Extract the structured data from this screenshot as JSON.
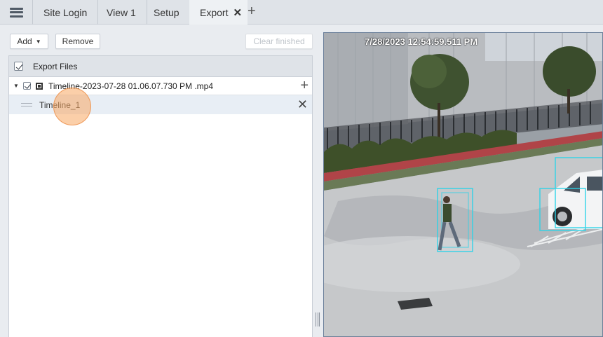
{
  "tabs": [
    {
      "label": "Site Login",
      "active": false
    },
    {
      "label": "View 1",
      "active": false
    },
    {
      "label": "Setup",
      "active": false
    },
    {
      "label": "Export",
      "active": true
    }
  ],
  "icons": {
    "menu": "hamburger-menu-icon",
    "tab_close": "close-icon",
    "tab_add": "plus-icon",
    "row_add": "plus-icon",
    "row_remove": "close-icon",
    "file": "film-icon",
    "expand": "caret-down-icon",
    "drag": "drag-handle-icon"
  },
  "toolbar": {
    "add_label": "Add",
    "remove_label": "Remove",
    "clear_label": "Clear finished"
  },
  "export_panel": {
    "header_label": "Export Files",
    "files": [
      {
        "name": "Timeline-2023-07-28 01.06.07.730 PM .mp4",
        "checked": true,
        "expanded": true,
        "segments": [
          {
            "name": "Timeline_1"
          }
        ]
      }
    ]
  },
  "video": {
    "timestamp": "7/28/2023 12:54:59.511 PM",
    "detection_box_color": "#2ad3e8"
  },
  "colors": {
    "accent_click": "#f8a762",
    "tab_bar": "#dfe3e8",
    "selected_row": "#e8eef5"
  }
}
